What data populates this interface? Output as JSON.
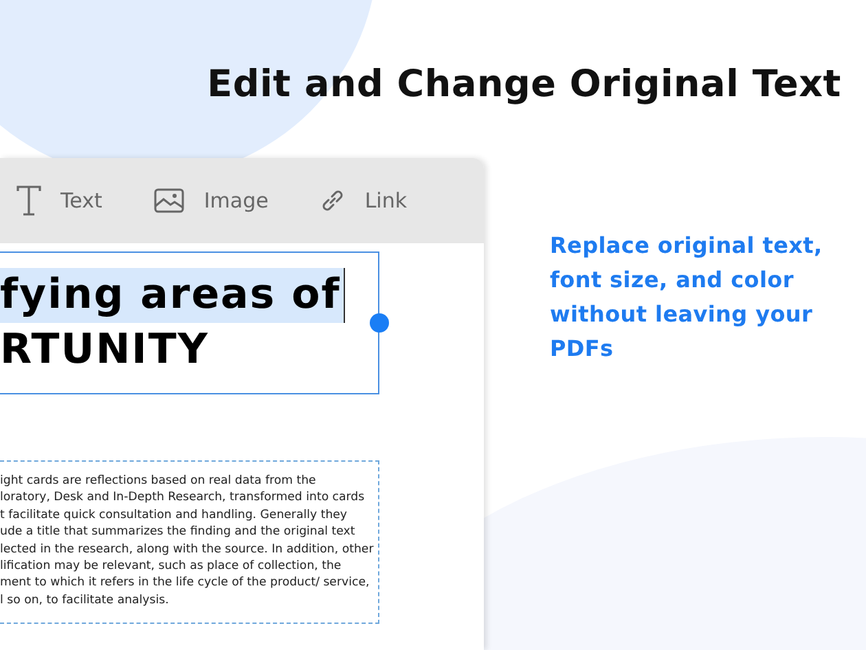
{
  "heading": "Edit and Change Original Text",
  "toolbar": [
    {
      "kind": "text",
      "label": "Text"
    },
    {
      "kind": "image",
      "label": "Image"
    },
    {
      "kind": "link",
      "label": "Link"
    }
  ],
  "editor": {
    "title_lines": [
      {
        "text": "fying areas of",
        "selected": true
      },
      {
        "text": "RTUNITY",
        "selected": false
      }
    ],
    "body_lines": [
      "ight cards are reflections based on real data from the",
      "loratory, Desk and In-Depth Research, transformed into cards",
      "t facilitate quick consultation and handling. Generally they",
      "ude a title that summarizes the finding and the original text",
      "lected in the research, along with the source. In addition, other",
      "lification may be relevant, such as place of collection, the",
      "ment to which it refers in the life cycle of the product/ service,",
      "l so on, to facilitate analysis."
    ]
  },
  "description": "Replace original text, font size, and color without leaving your PDFs"
}
